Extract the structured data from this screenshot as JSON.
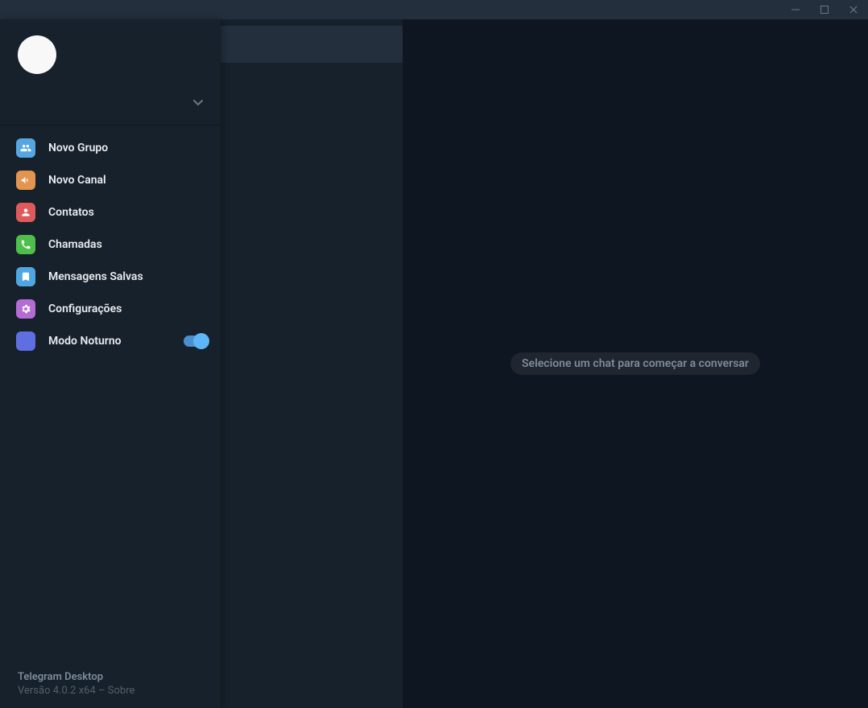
{
  "menu": {
    "items": [
      {
        "id": "new-group",
        "label": "Novo Grupo",
        "icon": "group-icon",
        "bg": "bg-blue"
      },
      {
        "id": "new-channel",
        "label": "Novo Canal",
        "icon": "megaphone-icon",
        "bg": "bg-orange"
      },
      {
        "id": "contacts",
        "label": "Contatos",
        "icon": "person-icon",
        "bg": "bg-red"
      },
      {
        "id": "calls",
        "label": "Chamadas",
        "icon": "phone-icon",
        "bg": "bg-green"
      },
      {
        "id": "saved",
        "label": "Mensagens Salvas",
        "icon": "bookmark-icon",
        "bg": "bg-sky"
      },
      {
        "id": "settings",
        "label": "Configurações",
        "icon": "gear-icon",
        "bg": "bg-purple"
      },
      {
        "id": "night-mode",
        "label": "Modo Noturno",
        "icon": "moon-icon",
        "bg": "bg-indigo",
        "toggle": true,
        "toggle_on": true
      }
    ]
  },
  "footer": {
    "app_name": "Telegram Desktop",
    "version_line": "Versão 4.0.2 x64 – Sobre"
  },
  "main": {
    "empty_message": "Selecione um chat para começar a conversar"
  }
}
